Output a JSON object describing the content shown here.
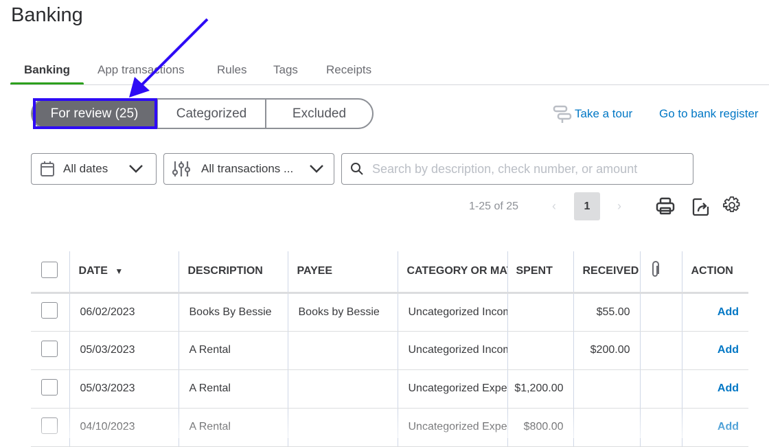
{
  "page": {
    "title": "Banking"
  },
  "tabs": [
    "Banking",
    "App transactions",
    "Rules",
    "Tags",
    "Receipts"
  ],
  "segments": {
    "for_review": "For review (25)",
    "categorized": "Categorized",
    "excluded": "Excluded"
  },
  "links": {
    "tour": "Take a tour",
    "register": "Go to bank register"
  },
  "filters": {
    "dates": "All dates",
    "transactions": "All transactions ...",
    "search_placeholder": "Search by description, check number, or amount"
  },
  "pagination": {
    "range": "1-25 of 25",
    "current": "1",
    "prev": "‹",
    "next": "›"
  },
  "table": {
    "headers": [
      "",
      "DATE",
      "DESCRIPTION",
      "PAYEE",
      "CATEGORY OR MATCH",
      "SPENT",
      "RECEIVED",
      "",
      "ACTION"
    ],
    "rows": [
      {
        "date": "06/02/2023",
        "description": "Books By Bessie",
        "payee": "Books by Bessie",
        "category": "Uncategorized Income",
        "spent": "",
        "received": "$55.00",
        "action": "Add"
      },
      {
        "date": "05/03/2023",
        "description": "A Rental",
        "payee": "",
        "category": "Uncategorized Income",
        "spent": "",
        "received": "$200.00",
        "action": "Add"
      },
      {
        "date": "05/03/2023",
        "description": "A Rental",
        "payee": "",
        "category": "Uncategorized Expense",
        "spent": "$1,200.00",
        "received": "",
        "action": "Add"
      },
      {
        "date": "04/10/2023",
        "description": "A Rental",
        "payee": "",
        "category": "Uncategorized Expense",
        "spent": "$800.00",
        "received": "",
        "action": "Add"
      }
    ]
  },
  "colors": {
    "accent": "#0077c5",
    "green": "#2ca01c",
    "highlight": "#2e0bf5"
  }
}
